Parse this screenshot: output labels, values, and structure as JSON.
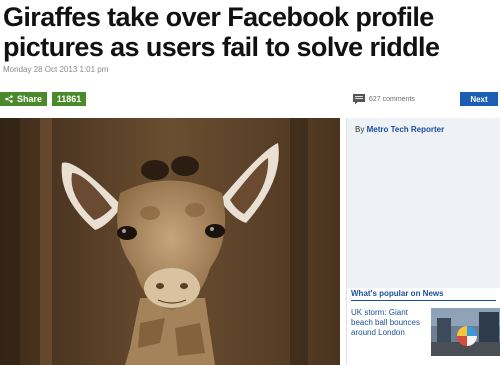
{
  "article": {
    "headline": "Giraffes take over Facebook profile pictures as users fail to solve riddle",
    "dateline": "Monday 28 Oct 2013 1:01 pm"
  },
  "toolbar": {
    "share_label": "Share",
    "share_count": "11861",
    "comments_label": "627 comments",
    "next_label": "Next"
  },
  "sidebar": {
    "byline_prefix": "By",
    "byline_author": "Metro Tech Reporter",
    "popular_heading": "What's popular on News",
    "popular_items": [
      {
        "title": "UK storm: Giant beach ball bounces around London"
      }
    ]
  },
  "icons": {
    "share": "share-icon",
    "comments": "speech-bubble-icon"
  },
  "colors": {
    "share_green": "#4a8a2a",
    "next_blue": "#1a5fb4",
    "link_blue": "#1a4f9c"
  }
}
